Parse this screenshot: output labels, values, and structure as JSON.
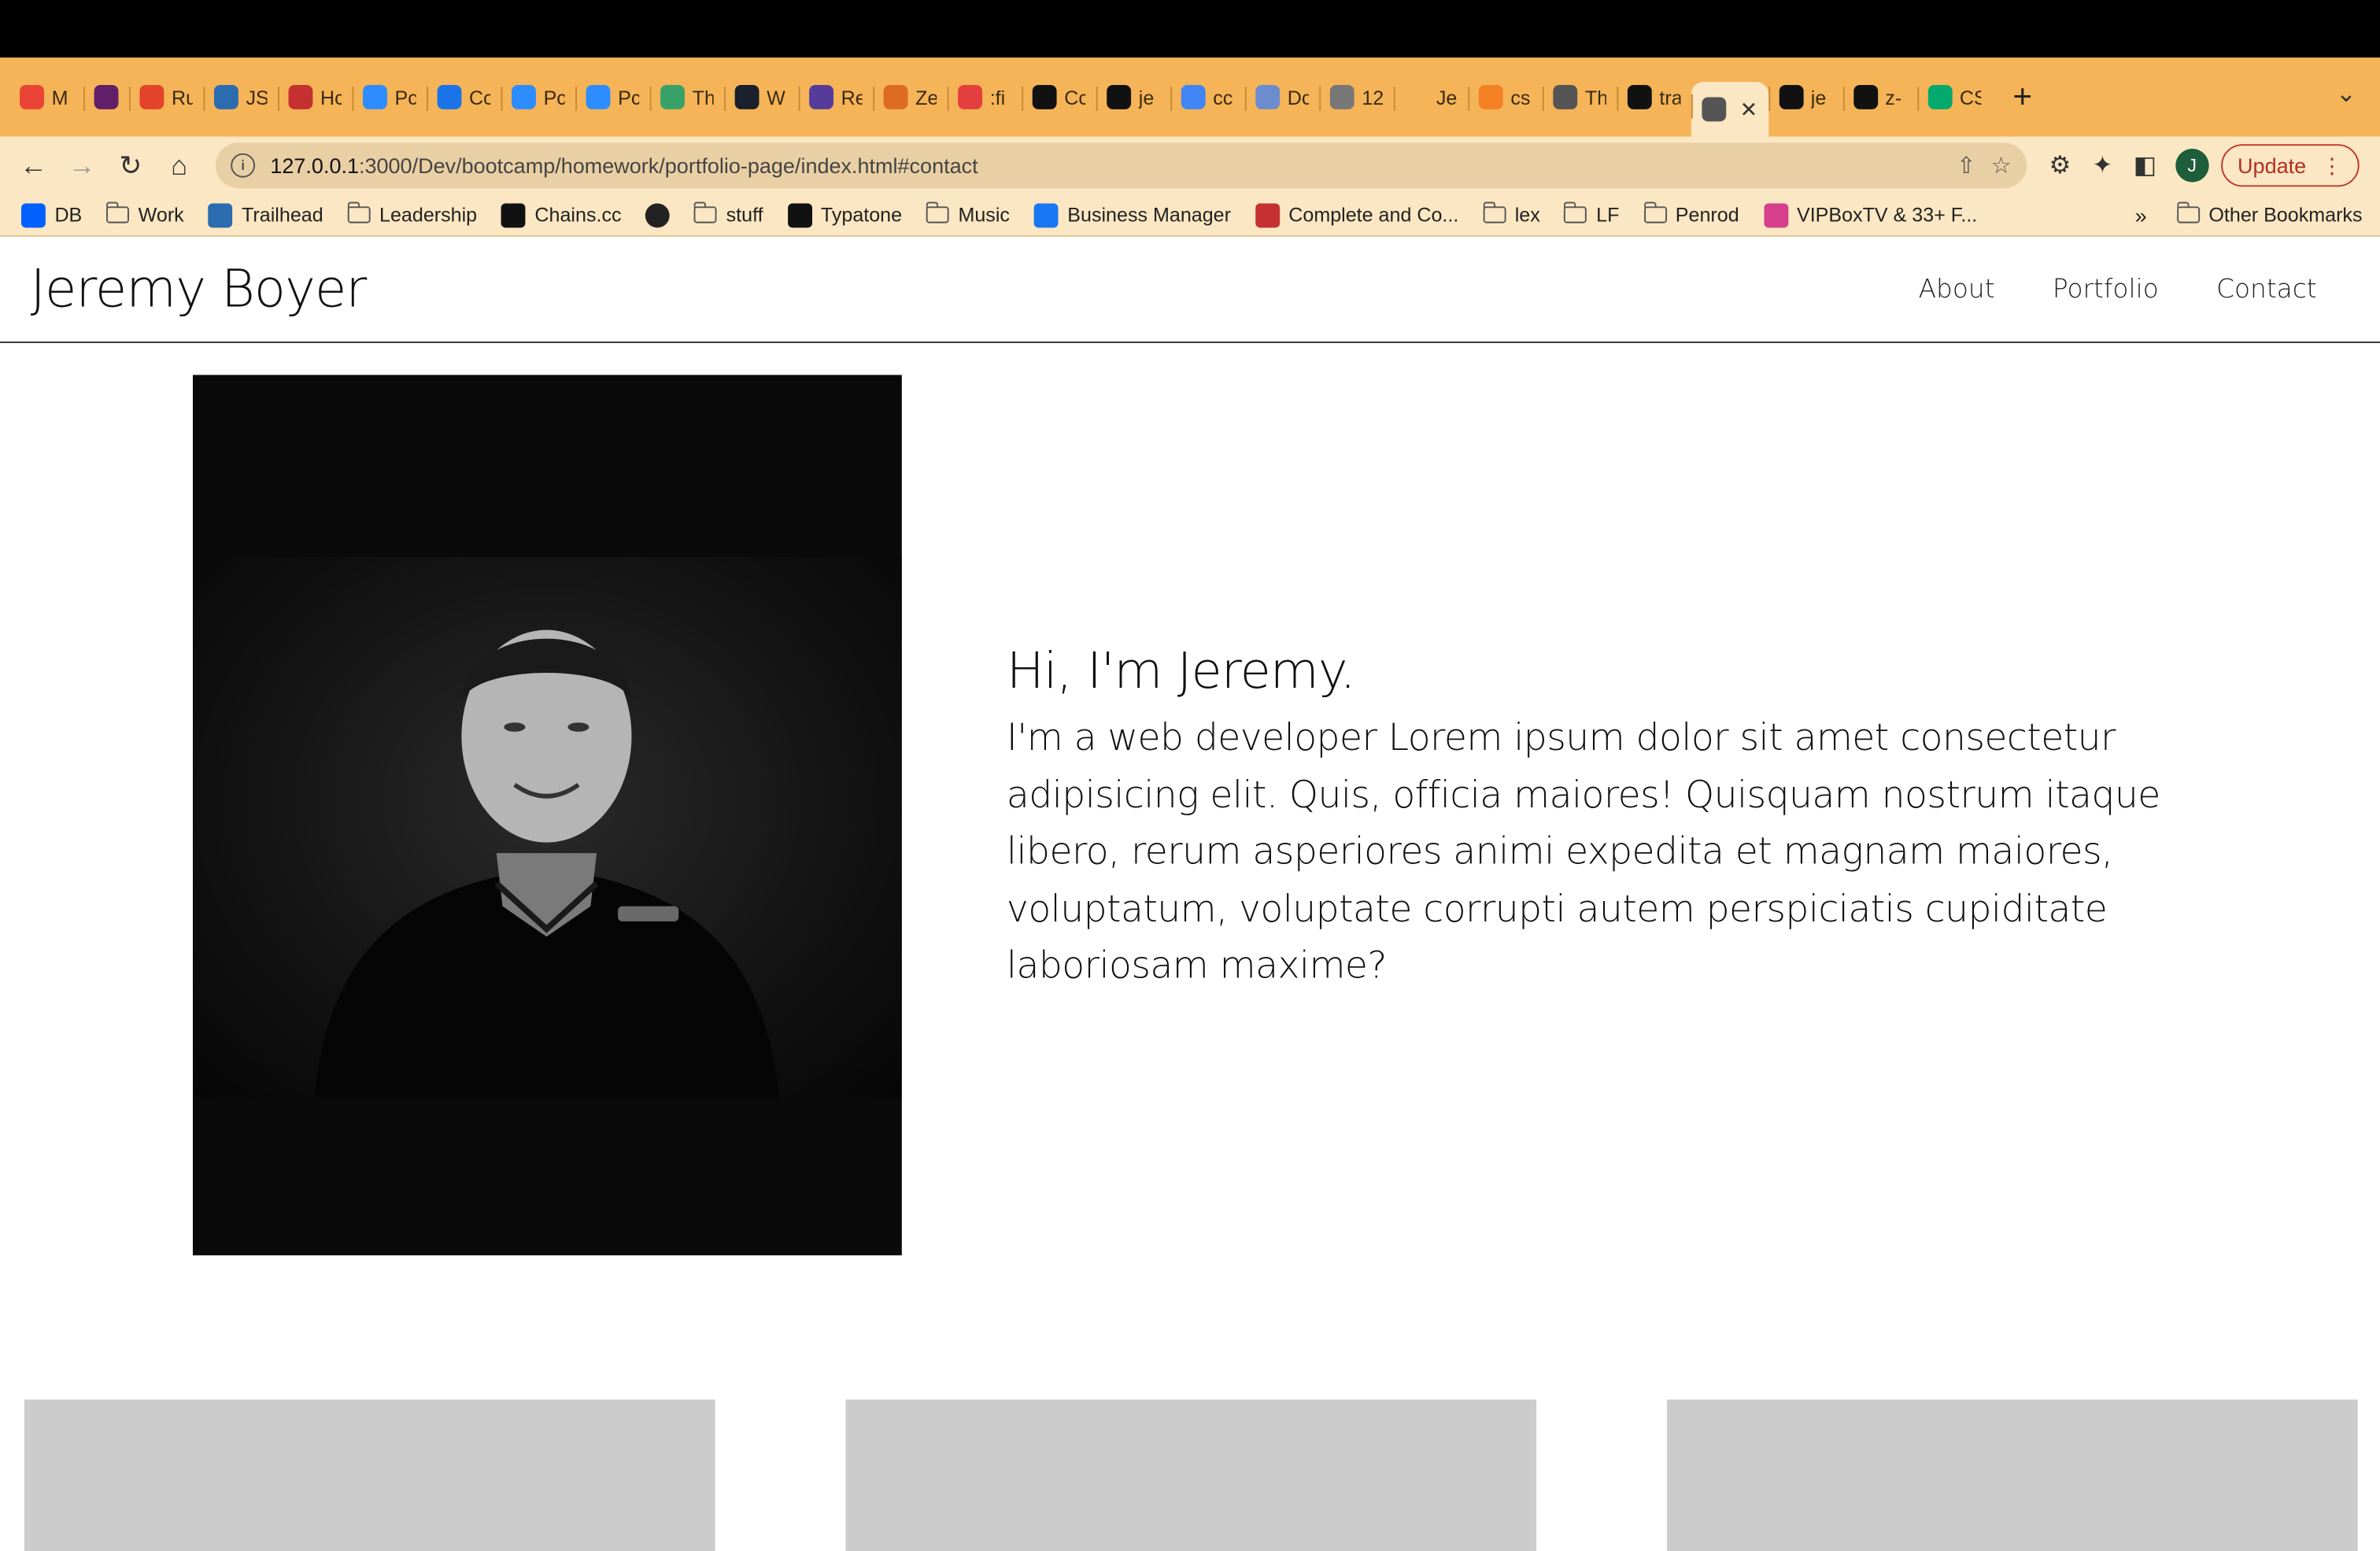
{
  "browser": {
    "tabs": [
      {
        "title": "M",
        "icon": "gmail-icon",
        "color": "#ea4335"
      },
      {
        "title": "",
        "icon": "slack-icon",
        "color": "#611f69",
        "pinned": true
      },
      {
        "title": "Ru",
        "icon": "gitlab-icon",
        "color": "#e24329"
      },
      {
        "title": "JS",
        "icon": "grid-icon",
        "color": "#2b6cb0"
      },
      {
        "title": "Hc",
        "icon": "r-icon",
        "color": "#c53030"
      },
      {
        "title": "Pc",
        "icon": "zoom-icon",
        "color": "#2d8cff"
      },
      {
        "title": "Cc",
        "icon": "circle-c-icon",
        "color": "#1a73e8"
      },
      {
        "title": "Pc",
        "icon": "zoom-icon",
        "color": "#2d8cff"
      },
      {
        "title": "Pc",
        "icon": "zoom-icon",
        "color": "#2d8cff"
      },
      {
        "title": "Th",
        "icon": "n-icon",
        "color": "#38a169"
      },
      {
        "title": "W",
        "icon": "x-icon",
        "color": "#1a202c"
      },
      {
        "title": "Re",
        "icon": "m-icon",
        "color": "#553c9a"
      },
      {
        "title": "Ze",
        "icon": "g2-icon",
        "color": "#dd6b20"
      },
      {
        "title": ":fi",
        "icon": "asterisk-icon",
        "color": "#e53e3e"
      },
      {
        "title": "Cc",
        "icon": "dots-icon",
        "color": "#111"
      },
      {
        "title": "je",
        "icon": "github-icon",
        "color": "#111"
      },
      {
        "title": "cc",
        "icon": "google-icon",
        "color": "#4285f4"
      },
      {
        "title": "Dc",
        "icon": "w-icon",
        "color": "#6b8cce"
      },
      {
        "title": "12",
        "icon": "globe-icon",
        "color": "#777"
      },
      {
        "title": "Je",
        "icon": "blank-icon",
        "color": "#f5b457"
      },
      {
        "title": "cs",
        "icon": "stack-icon",
        "color": "#f48024"
      },
      {
        "title": "Th",
        "icon": "globe-icon",
        "color": "#555"
      },
      {
        "title": "tra",
        "icon": "m-bold-icon",
        "color": "#111"
      },
      {
        "title": "",
        "icon": "globe-icon",
        "color": "#555",
        "active": true
      },
      {
        "title": "je",
        "icon": "github-icon",
        "color": "#111"
      },
      {
        "title": "z-",
        "icon": "m-bold-icon",
        "color": "#111"
      },
      {
        "title": "CS",
        "icon": "w3-icon",
        "color": "#04aa6d"
      }
    ],
    "new_tab": "+",
    "url": "127.0.0.1:3000/Dev/bootcamp/homework/portfolio-page/index.html#contact",
    "url_host": "127.0.0.1",
    "url_rest": ":3000/Dev/bootcamp/homework/portfolio-page/index.html#contact",
    "profile_initial": "J",
    "update_label": "Update",
    "bookmarks": [
      {
        "label": "DB",
        "type": "dropbox"
      },
      {
        "label": "Work",
        "type": "folder"
      },
      {
        "label": "Trailhead",
        "type": "trailhead"
      },
      {
        "label": "Leadership",
        "type": "folder"
      },
      {
        "label": "Chains.cc",
        "type": "chains"
      },
      {
        "label": "",
        "type": "globe"
      },
      {
        "label": "stuff",
        "type": "folder"
      },
      {
        "label": "Typatone",
        "type": "typatone"
      },
      {
        "label": "Music",
        "type": "folder"
      },
      {
        "label": "Business Manager",
        "type": "meta"
      },
      {
        "label": "Complete and Co...",
        "type": "diamond"
      },
      {
        "label": "lex",
        "type": "folder"
      },
      {
        "label": "LF",
        "type": "folder"
      },
      {
        "label": "Penrod",
        "type": "folder"
      },
      {
        "label": "VIPBoxTV & 33+ F...",
        "type": "vip"
      }
    ],
    "bookmarks_more": "»",
    "other_bookmarks": "Other Bookmarks"
  },
  "site": {
    "brand": "Jeremy Boyer",
    "nav": [
      "About",
      "Portfolio",
      "Contact"
    ],
    "intro_heading": "Hi, I'm Jeremy.",
    "intro_body": "I'm a web developer Lorem ipsum dolor sit amet consectetur adipisicing elit. Quis, officia maiores! Quisquam nostrum itaque libero, rerum asperiores animi expedita et magnam maiores, voluptatum, voluptate corrupti autem perspiciatis cupiditate laboriosam maxime?"
  },
  "colors": {
    "tab_strip": "#f5b457",
    "toolbar": "#fbe7c3",
    "card_placeholder": "#cccccc",
    "photo_bg": "#0a0a0a"
  }
}
